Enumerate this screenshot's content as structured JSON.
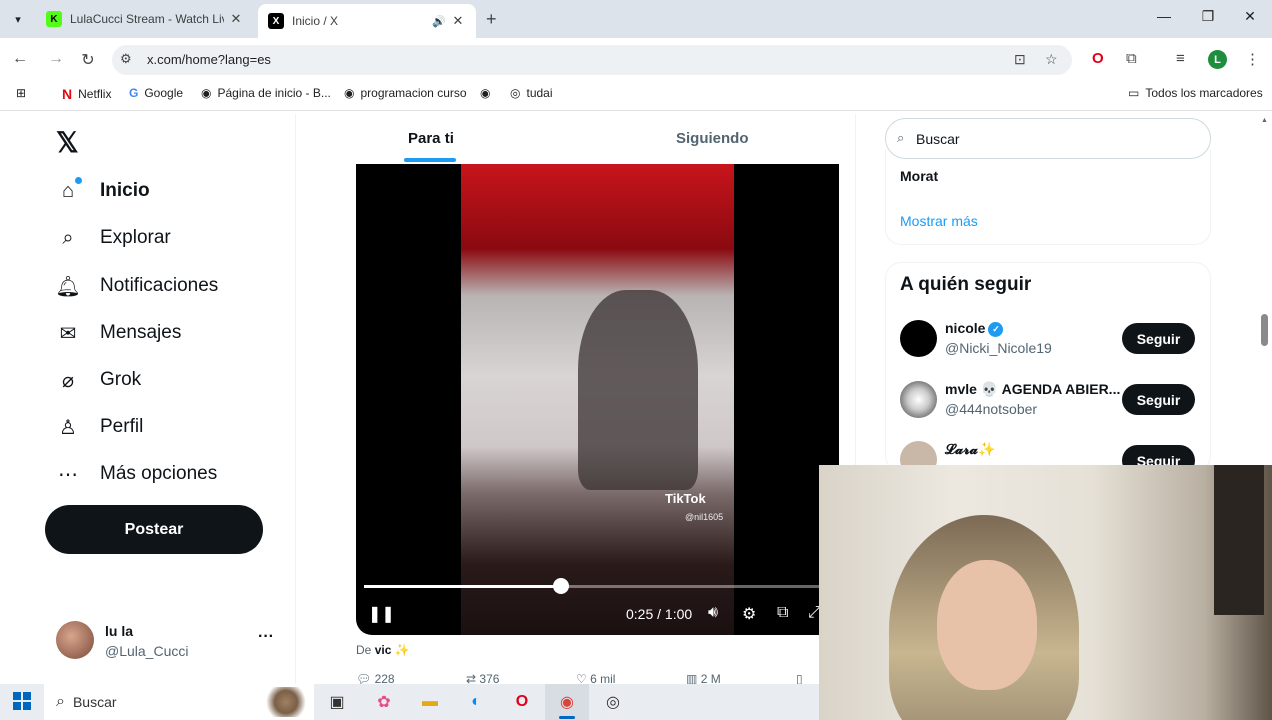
{
  "browser": {
    "tabs": [
      {
        "title": "LulaCucci Stream - Watch Live o",
        "favicon": "kick-icon"
      },
      {
        "title": "Inicio / X",
        "favicon": "x-icon",
        "active": true,
        "audio": true
      }
    ],
    "url": "x.com/home?lang=es",
    "profile_initial": "L",
    "bookmarks": [
      {
        "label": "Netflix",
        "icon": "netflix-icon"
      },
      {
        "label": "Google",
        "icon": "google-icon"
      },
      {
        "label": "Página de inicio - B...",
        "icon": "globe-icon"
      },
      {
        "label": "programacion curso",
        "icon": "globe-icon"
      },
      {
        "label": "",
        "icon": "globe-icon"
      },
      {
        "label": "tudai",
        "icon": "tudai-icon"
      }
    ],
    "all_bookmarks": "Todos los marcadores"
  },
  "x": {
    "nav": [
      {
        "label": "Inicio",
        "icon": "home-icon"
      },
      {
        "label": "Explorar",
        "icon": "search-icon"
      },
      {
        "label": "Notificaciones",
        "icon": "bell-icon"
      },
      {
        "label": "Mensajes",
        "icon": "mail-icon"
      },
      {
        "label": "Grok",
        "icon": "grok-icon"
      },
      {
        "label": "Perfil",
        "icon": "person-icon"
      },
      {
        "label": "Más opciones",
        "icon": "more-circle-icon"
      }
    ],
    "post_button": "Postear",
    "profile": {
      "name": "lu la",
      "handle": "@Lula_Cucci"
    },
    "feed_tabs": {
      "active": "Para ti",
      "inactive": "Siguiendo"
    },
    "video": {
      "watermark": "TikTok",
      "watermark_handle": "@nil1605",
      "time": "0:25 / 1:00",
      "progress_fraction": 0.42
    },
    "credit": {
      "prefix": "De",
      "name": "vic ✨"
    },
    "actions": {
      "replies": "228",
      "reposts": "376",
      "likes": "6 mil",
      "views": "2 M"
    },
    "sidebar": {
      "search_placeholder": "Buscar",
      "trend": "Morat",
      "show_more": "Mostrar más",
      "who_to_follow_title": "A quién seguir",
      "suggestions": [
        {
          "name": "nicole",
          "handle": "@Nicki_Nicole19",
          "verified": true,
          "button": "Seguir"
        },
        {
          "name": "mvle 💀 AGENDA ABIER...",
          "handle": "@444notsober",
          "verified": false,
          "button": "Seguir"
        },
        {
          "name": "𝓛𝓪𝓻𝓪✨",
          "handle": "",
          "verified": false,
          "button": "Seguir"
        }
      ]
    }
  },
  "taskbar": {
    "search": "Buscar"
  }
}
